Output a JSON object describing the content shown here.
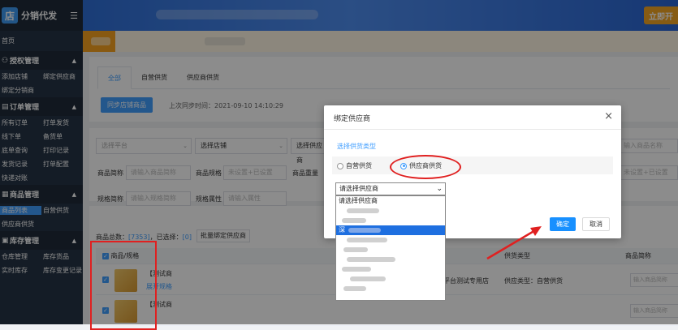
{
  "app": {
    "logo_char": "店",
    "name": "分销代发"
  },
  "sidebar": {
    "home": "首页",
    "groups": [
      {
        "title": "授权管理",
        "rows": [
          [
            "添加店铺",
            "绑定供应商"
          ],
          [
            "绑定分销商"
          ]
        ]
      },
      {
        "title": "订单管理",
        "rows": [
          [
            "所有订单",
            "打单发货"
          ],
          [
            "线下单",
            "备货单"
          ],
          [
            "底单查询",
            "打印记录"
          ],
          [
            "发货记录",
            "打单配置"
          ],
          [
            "快递对账"
          ]
        ]
      },
      {
        "title": "商品管理",
        "rows": [
          [
            "商品列表",
            "自营供货"
          ],
          [
            "供应商供货"
          ]
        ]
      },
      {
        "title": "库存管理",
        "rows": [
          [
            "仓库管理",
            "库存货品"
          ],
          [
            "实时库存",
            "库存变更记录"
          ]
        ]
      }
    ],
    "active_item": "商品列表"
  },
  "topbar": {
    "cta": "立即开"
  },
  "tabs": [
    "全部",
    "自营供货",
    "供应商供货"
  ],
  "sync": {
    "button": "同步店铺商品",
    "last_sync": "上次同步时间：2021-09-10 14:10:29"
  },
  "filters": {
    "row1": [
      "选择平台",
      "选择店铺",
      "选择供应商"
    ],
    "row1_right": "输入商品名称",
    "row2": [
      {
        "label": "商品简称",
        "placeholder": "请输入商品简称"
      },
      {
        "label": "商品规格",
        "placeholder": "未设置+已设置"
      },
      {
        "label": "商品重量",
        "placeholder": ""
      }
    ],
    "row2_right": "未设置+已设置",
    "row3": [
      {
        "label": "规格简称",
        "placeholder": "请输入规格简称"
      },
      {
        "label": "规格属性",
        "placeholder": "请输入属性"
      }
    ]
  },
  "list": {
    "count_label": "商品总数：",
    "count_value": "[7353]",
    "selected_label": "，已选择：",
    "selected_value": "[0]",
    "bulk_button": "批量绑定供应商",
    "headers": {
      "product": "商品/规格",
      "supply_type": "供货类型",
      "short_name": "商品简称"
    },
    "rows": [
      {
        "name": "【测试商",
        "expand": "展开规格",
        "shop": "平台测试专用店",
        "supply": "供应类型：自营供货",
        "input": "输入商品简称"
      },
      {
        "name": "【测试商",
        "expand": "",
        "shop": "",
        "supply": "",
        "input": "输入商品简称"
      }
    ]
  },
  "modal": {
    "title": "绑定供应商",
    "close": "×",
    "subtitle": "选择供货类型",
    "option_self": "自营供货",
    "option_supplier": "供应商供货",
    "select_value": "请选择供应商",
    "dropdown_first": "请选择供应商",
    "dropdown_highlight": "深",
    "ok": "确定",
    "cancel": "取消"
  },
  "colors": {
    "primary": "#409eff",
    "sidebar": "#263445",
    "annotation": "#e02020",
    "orange": "#f5a623"
  }
}
